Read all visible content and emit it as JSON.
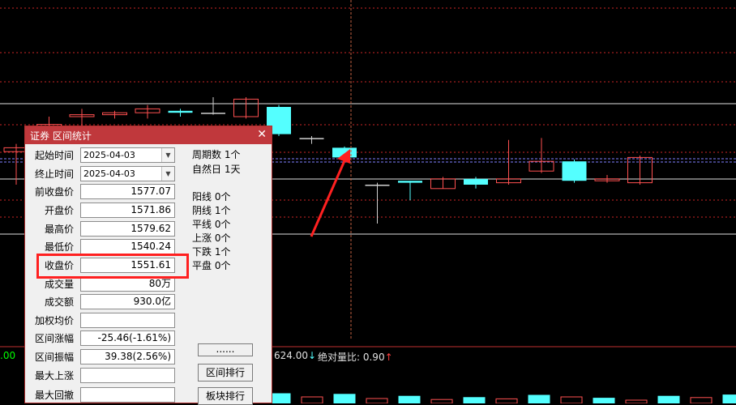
{
  "dialog": {
    "title": "证券 区间统计",
    "start_label": "起始时间",
    "start_value": "2025-04-03",
    "end_label": "终止时间",
    "end_value": "2025-04-03",
    "fields": [
      {
        "label": "前收盘价",
        "value": "1577.07"
      },
      {
        "label": "开盘价",
        "value": "1571.86"
      },
      {
        "label": "最高价",
        "value": "1579.62"
      },
      {
        "label": "最低价",
        "value": "1540.24"
      },
      {
        "label": "收盘价",
        "value": "1551.61"
      },
      {
        "label": "成交量",
        "value": "80万"
      },
      {
        "label": "成交额",
        "value": "930.0亿"
      },
      {
        "label": "加权均价",
        "value": ""
      },
      {
        "label": "区间涨幅",
        "value": "-25.46(-1.61%)"
      },
      {
        "label": "区间振幅",
        "value": "39.38(2.56%)"
      },
      {
        "label": "最大上涨",
        "value": ""
      },
      {
        "label": "最大回撤",
        "value": ""
      }
    ],
    "period_text": "周期数 1个",
    "natural_days_text": "自然日 1天",
    "stats": [
      "阳线 0个",
      "阴线 1个",
      "平线 0个",
      "上涨 0个",
      "下跌 1个",
      "平盘 0个"
    ],
    "more_button": "......",
    "range_rank_button": "区间排行",
    "sector_rank_button": "板块排行",
    "highlighted_field": "收盘价"
  },
  "status_bar": {
    "left_fragment": ".00",
    "value_text": "624.00",
    "down_arrow": "↓",
    "volume_ratio_text": "绝对量比: 0.90",
    "up_arrow": "↑"
  },
  "colors": {
    "dialog_title_bg": "#c0383c",
    "highlight_box": "#ff2020",
    "arrow": "#ff2020",
    "down_candle": "#54ffff",
    "up_candle": "#ff5050",
    "grid": "#ff3030"
  },
  "chart": {
    "candles": [
      {
        "kind": "up",
        "o": 1577,
        "h": 1581,
        "l": 1560,
        "c": 1579
      },
      {
        "kind": "up",
        "o": 1588,
        "h": 1595,
        "l": 1582,
        "c": 1591
      },
      {
        "kind": "up",
        "o": 1595,
        "h": 1599,
        "l": 1590,
        "c": 1596
      },
      {
        "kind": "up",
        "o": 1596,
        "h": 1598,
        "l": 1594,
        "c": 1597
      },
      {
        "kind": "up",
        "o": 1597,
        "h": 1601,
        "l": 1594,
        "c": 1599
      },
      {
        "kind": "down",
        "o": 1598,
        "h": 1599,
        "l": 1595,
        "c": 1597
      },
      {
        "kind": "flat",
        "o": 1597,
        "h": 1605,
        "l": 1596,
        "c": 1597
      },
      {
        "kind": "up",
        "o": 1595,
        "h": 1605,
        "l": 1594,
        "c": 1604
      },
      {
        "kind": "down",
        "o": 1600,
        "h": 1601,
        "l": 1585,
        "c": 1586
      },
      {
        "kind": "flat",
        "o": 1584,
        "h": 1585,
        "l": 1581,
        "c": 1584
      },
      {
        "kind": "down",
        "o": 1579,
        "h": 1579.62,
        "l": 1575,
        "c": 1574
      },
      {
        "kind": "flat",
        "o": 1560,
        "h": 1561,
        "l": 1540,
        "c": 1560
      },
      {
        "kind": "down",
        "o": 1562,
        "h": 1562,
        "l": 1552,
        "c": 1561
      },
      {
        "kind": "up",
        "o": 1558,
        "h": 1564,
        "l": 1558,
        "c": 1563
      },
      {
        "kind": "down",
        "o": 1563,
        "h": 1564,
        "l": 1558,
        "c": 1560
      },
      {
        "kind": "up",
        "o": 1561,
        "h": 1583,
        "l": 1560,
        "c": 1563
      },
      {
        "kind": "up",
        "o": 1567,
        "h": 1584,
        "l": 1566,
        "c": 1572
      },
      {
        "kind": "down",
        "o": 1572,
        "h": 1573,
        "l": 1561,
        "c": 1562
      },
      {
        "kind": "up",
        "o": 1562,
        "h": 1565,
        "l": 1561,
        "c": 1563
      },
      {
        "kind": "up",
        "o": 1561,
        "h": 1575,
        "l": 1560,
        "c": 1574
      }
    ],
    "volume": [
      30,
      20,
      28,
      15,
      22,
      12,
      18,
      14,
      25,
      20,
      16,
      10,
      22,
      18,
      26,
      14
    ]
  }
}
